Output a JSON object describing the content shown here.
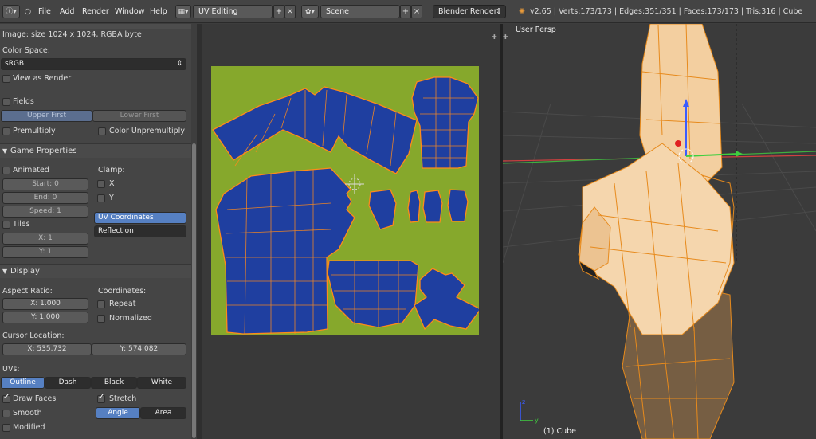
{
  "topbar": {
    "menus": [
      "File",
      "Add",
      "Render",
      "Window",
      "Help"
    ],
    "screen_layout": "UV Editing",
    "scene": "Scene",
    "render_engine": "Blender Render",
    "info": "v2.65 | Verts:173/173 | Edges:351/351 | Faces:173/173 | Tris:316 | Cube"
  },
  "left_panel": {
    "image_info": "Image: size 1024 x 1024, RGBA byte",
    "color_space_label": "Color Space:",
    "color_space_value": "sRGB",
    "view_as_render": "View as Render",
    "fields": "Fields",
    "upper_first": "Upper First",
    "lower_first": "Lower First",
    "premultiply": "Premultiply",
    "color_unpremultiply": "Color Unpremultiply",
    "game_properties": {
      "header": "Game Properties",
      "animated": "Animated",
      "clamp": "Clamp:",
      "clamp_x": "X",
      "clamp_y": "Y",
      "start": "Start: 0",
      "end": "End: 0",
      "speed": "Speed: 1",
      "tiles": "Tiles",
      "tile_x": "X: 1",
      "tile_y": "Y: 1",
      "mapping_uv": "UV Coordinates",
      "mapping_reflection": "Reflection"
    },
    "display": {
      "header": "Display",
      "aspect_ratio": "Aspect Ratio:",
      "aspect_x": "X: 1.000",
      "aspect_y": "Y: 1.000",
      "coordinates": "Coordinates:",
      "repeat": "Repeat",
      "normalized": "Normalized",
      "cursor_location": "Cursor Location:",
      "cursor_x": "X: 535.732",
      "cursor_y": "Y: 574.082",
      "uvs_label": "UVs:",
      "uv_modes": [
        "Outline",
        "Dash",
        "Black",
        "White"
      ],
      "draw_faces": "Draw Faces",
      "stretch": "Stretch",
      "smooth": "Smooth",
      "angle": "Angle",
      "area": "Area",
      "modified": "Modified"
    }
  },
  "viewport": {
    "persp_label": "User Persp",
    "object_label": "(1) Cube"
  },
  "colors": {
    "uv_background": "#86a82c",
    "island_fill": "#1f3fa0",
    "uv_edge": "#ff8a1a",
    "skin": "#f3cfa0",
    "active_button": "#5680c2"
  }
}
